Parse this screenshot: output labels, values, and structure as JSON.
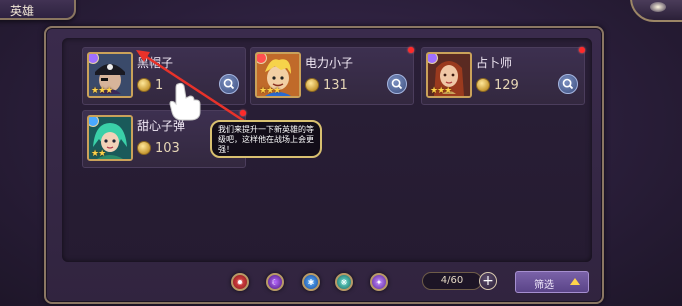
{
  "header": {
    "title": "英雄"
  },
  "heroes": [
    {
      "name": "黑帽子",
      "power": "131",
      "stars": "★★★",
      "element_color": "#a070ff",
      "portrait": "pirate",
      "red_dot": false,
      "partial_power": "1"
    },
    {
      "name": "电力小子",
      "power": "131",
      "stars": "★★★",
      "element_color": "#ff5050",
      "portrait": "blond",
      "red_dot": true
    },
    {
      "name": "占卜师",
      "power": "129",
      "stars": "★★★",
      "element_color": "#a070ff",
      "portrait": "fortune",
      "red_dot": true
    },
    {
      "name": "甜心子弹",
      "power": "103",
      "stars": "★★",
      "element_color": "#4aa8ff",
      "portrait": "green",
      "red_dot": true
    }
  ],
  "tutorial": {
    "message": "我们来提升一下新英雄的等级吧，这样他在战场上会更强！"
  },
  "filters": {
    "icons": [
      {
        "name": "fire-element-icon",
        "color": "#d4323c",
        "glyph": "✹"
      },
      {
        "name": "dark-element-icon",
        "color": "#8a3ac8",
        "glyph": "☾"
      },
      {
        "name": "water-element-icon",
        "color": "#2a7ad8",
        "glyph": "✱"
      },
      {
        "name": "nature-element-icon",
        "color": "#3ab0a8",
        "glyph": "❋"
      },
      {
        "name": "light-element-icon",
        "color": "#a060d8",
        "glyph": "✦"
      }
    ],
    "capacity": "4/60",
    "filter_label": "筛选"
  }
}
